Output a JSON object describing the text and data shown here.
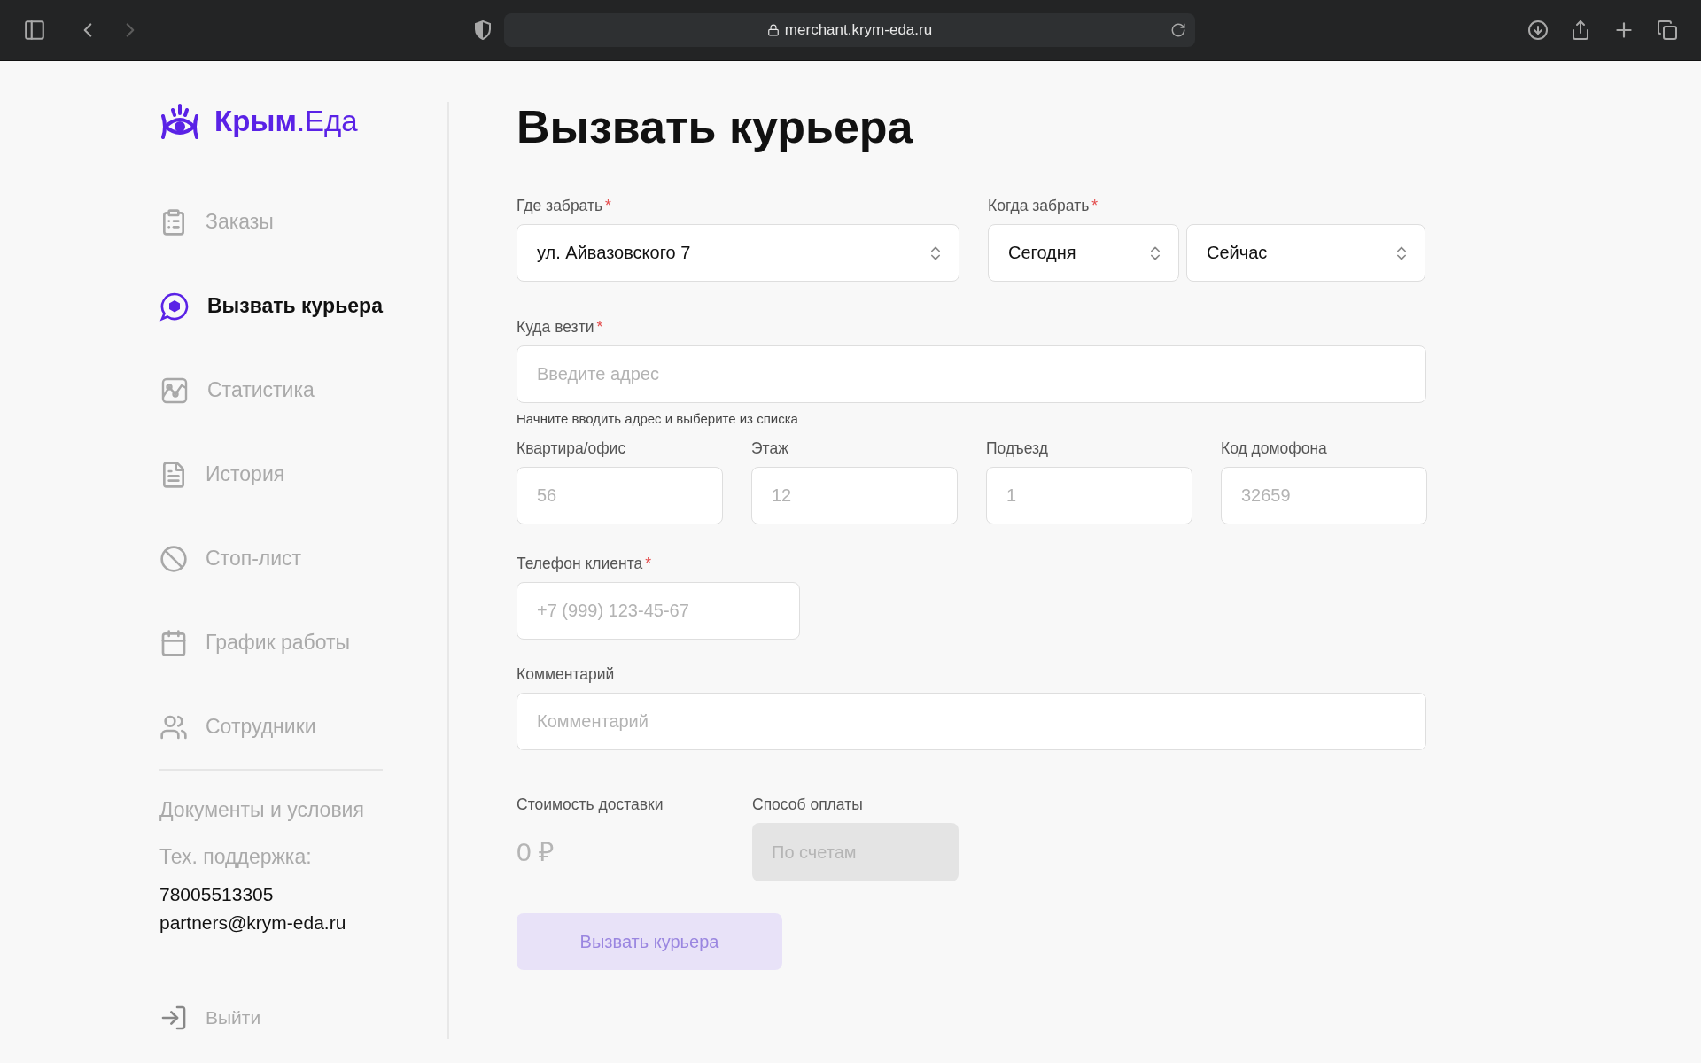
{
  "browser": {
    "url": "merchant.krym-eda.ru"
  },
  "sidebar": {
    "logo": {
      "bold": "Крым",
      "light": ".Еда"
    },
    "items": [
      {
        "label": "Заказы",
        "selected": false
      },
      {
        "label": "Вызвать курьера",
        "selected": true
      },
      {
        "label": "Статистика",
        "selected": false
      },
      {
        "label": "История",
        "selected": false
      },
      {
        "label": "Стоп-лист",
        "selected": false
      },
      {
        "label": "График работы",
        "selected": false
      },
      {
        "label": "Сотрудники",
        "selected": false
      }
    ],
    "documents_link": "Документы и условия",
    "support_label": "Тех. поддержка:",
    "support_phone": "78005513305",
    "support_email": "partners@krym-eda.ru",
    "logout": "Выйти"
  },
  "form": {
    "title": "Вызвать курьера",
    "pickup_row": [
      {
        "label": "Где забрать",
        "mark": "*",
        "selects": [
          "ул. Айвазовского 7"
        ]
      },
      {
        "label": "Когда забрать",
        "mark": "*",
        "selects": [
          "Сегодня",
          "Сейчас"
        ]
      }
    ],
    "destination": {
      "label": "Куда везти",
      "mark": "*",
      "placeholder": "Введите адрес",
      "hint": "Начните вводить адрес и выберите из списка"
    },
    "details": [
      {
        "label": "Квартира/офис",
        "placeholder": "56"
      },
      {
        "label": "Этаж",
        "placeholder": "12"
      },
      {
        "label": "Подъезд",
        "placeholder": "1"
      },
      {
        "label": "Код домофона",
        "placeholder": "32659"
      }
    ],
    "phone": {
      "label": "Телефон клиента",
      "mark": "*",
      "placeholder": "+7 (999) 123-45-67"
    },
    "comment": {
      "label": "Комментарий",
      "placeholder": "Комментарий"
    },
    "cost": {
      "label": "Стоимость доставки",
      "value": "0 ₽"
    },
    "payment": {
      "label": "Способ оплаты",
      "value": "По счетам",
      "disabled": true
    },
    "submit": {
      "label": "Вызвать курьера",
      "disabled": true
    }
  }
}
